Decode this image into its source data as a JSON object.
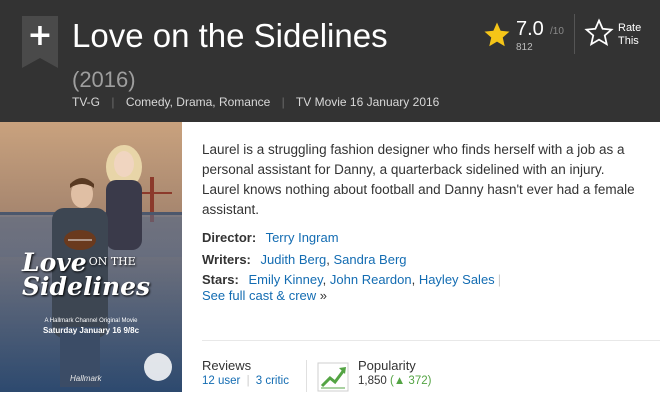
{
  "header": {
    "title": "Love on the Sidelines",
    "year": "(2016)",
    "rating_content": "TV-G",
    "genres": "Comedy, Drama, Romance",
    "release": "TV Movie 16 January 2016",
    "watchlist_icon": "plus-icon"
  },
  "rating": {
    "value": "7.0",
    "out_of": "/10",
    "count": "812",
    "star_color": "#f5c518",
    "rate_label_1": "Rate",
    "rate_label_2": "This"
  },
  "poster": {
    "title_line1": "Love",
    "title_on_the": "ON THE",
    "title_line2": "Sidelines",
    "tagline": "A Hallmark Channel Original Movie",
    "date": "Saturday January 16 9/8c",
    "brand": "Hallmark"
  },
  "summary": "Laurel is a struggling fashion designer who finds herself with a job as a personal assistant for Danny, a quarterback sidelined with an injury. Laurel knows nothing about football and Danny hasn't ever had a female assistant.",
  "credits": {
    "director_label": "Director:",
    "director": "Terry Ingram",
    "writers_label": "Writers:",
    "writer1": "Judith Berg",
    "writer2": "Sandra Berg",
    "stars_label": "Stars:",
    "star1": "Emily Kinney",
    "star2": "John Reardon",
    "star3": "Hayley Sales",
    "full_cast": "See full cast & crew",
    "full_cast_arrow": "»"
  },
  "reviews": {
    "label": "Reviews",
    "user": "12 user",
    "critic": "3 critic"
  },
  "popularity": {
    "label": "Popularity",
    "rank": "1,850",
    "delta_arrow": "▲",
    "delta": "372",
    "accent": "#54a444"
  }
}
